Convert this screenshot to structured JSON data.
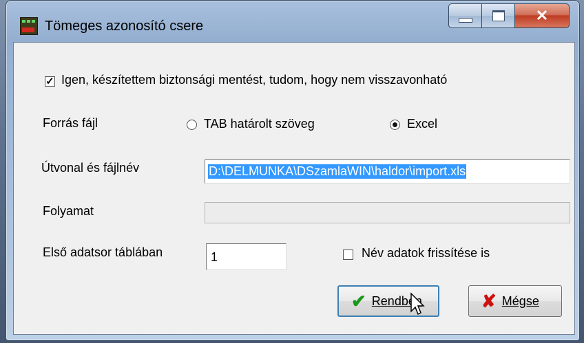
{
  "window": {
    "title": "Tömeges azonosító csere"
  },
  "backup_checkbox": {
    "label": "Igen, készítettem biztonsági mentést, tudom, hogy nem visszavonható",
    "checked": true
  },
  "source_file": {
    "label": "Forrás fájl",
    "options": [
      "TAB határolt szöveg",
      "Excel"
    ],
    "selected": "Excel"
  },
  "path": {
    "label": "Útvonal és fájlnév",
    "value": "D:\\DELMUNKA\\DSzamlaWIN\\haldor\\import.xls"
  },
  "progress": {
    "label": "Folyamat",
    "value": 0
  },
  "first_row": {
    "label": "Első adatsor táblában",
    "value": "1"
  },
  "name_update": {
    "label": "Név adatok frissítése is",
    "checked": false
  },
  "buttons": {
    "ok_label": "Rendben",
    "cancel_label": "Mégse"
  },
  "colors": {
    "ok_icon": "#1a9a1a",
    "cancel_icon": "#cc1111",
    "selection": "#3399ff"
  },
  "icons": {
    "ok": "checkmark-icon",
    "cancel": "x-icon"
  }
}
